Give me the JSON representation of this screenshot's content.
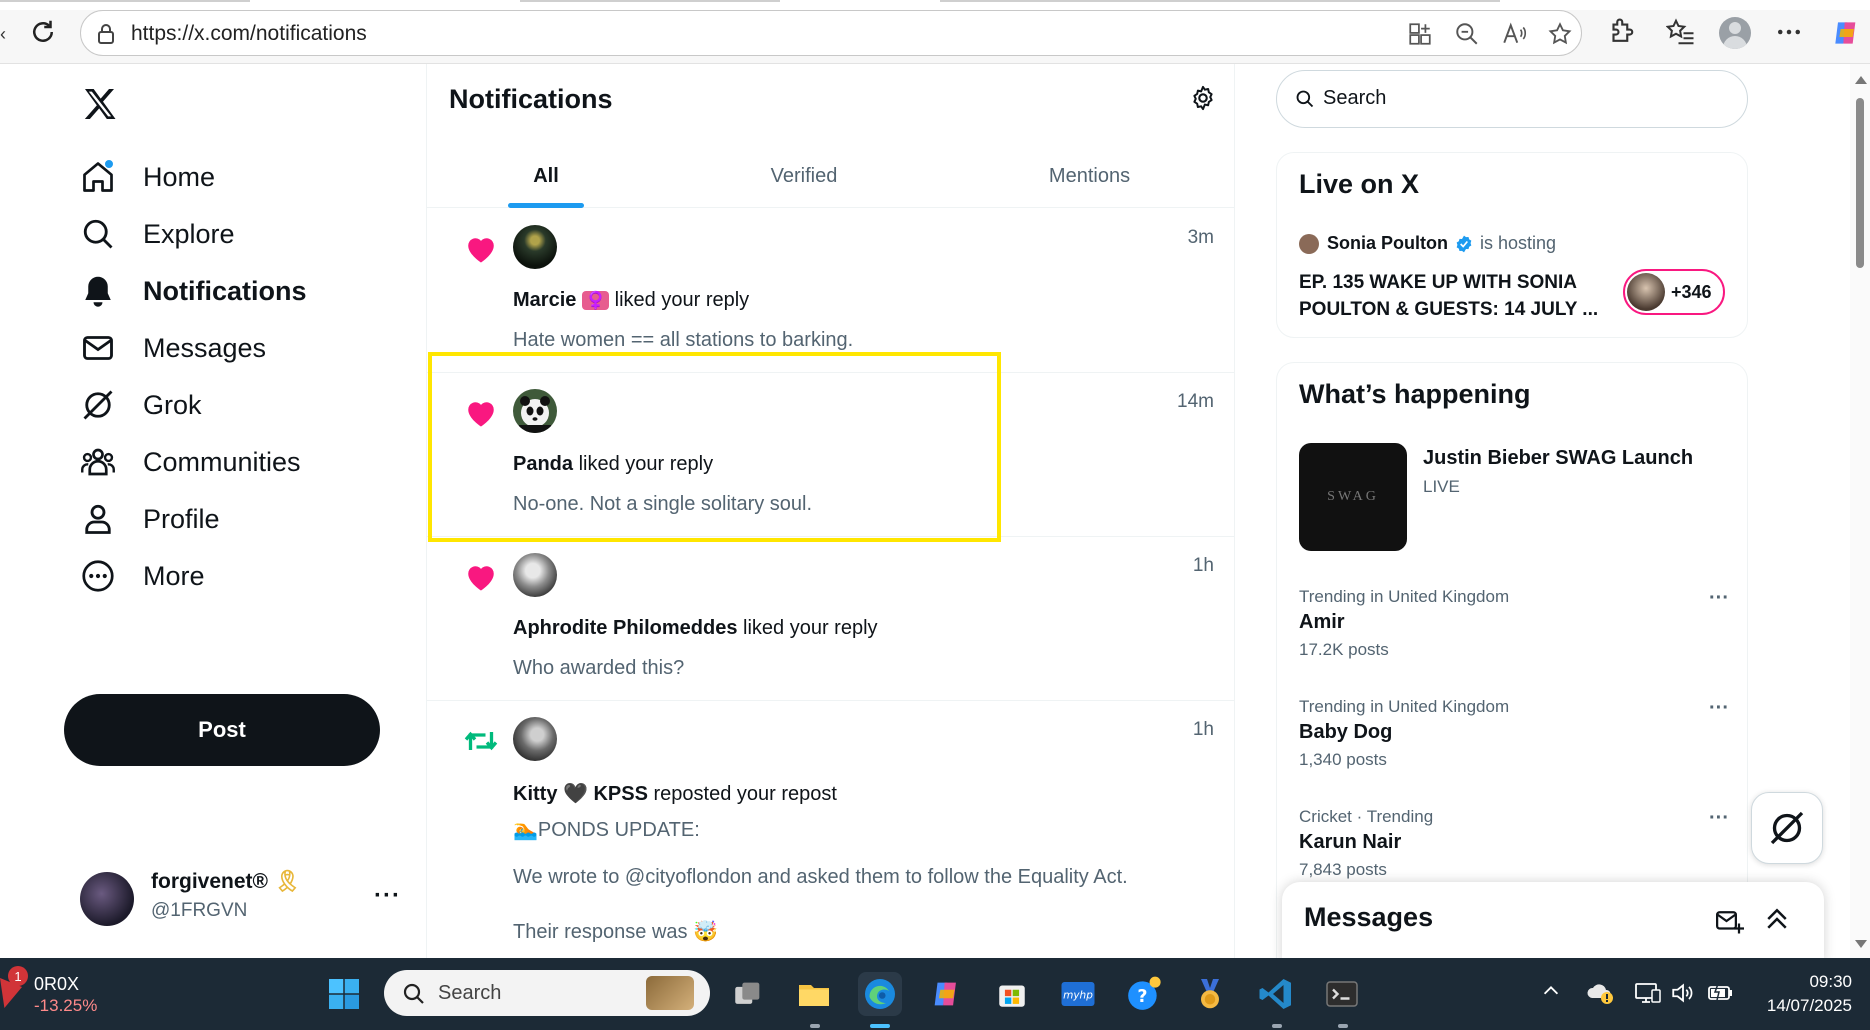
{
  "browser": {
    "url": "https://x.com/notifications"
  },
  "sidebar": {
    "items": [
      {
        "label": "Home",
        "icon": "home-icon"
      },
      {
        "label": "Explore",
        "icon": "search-icon"
      },
      {
        "label": "Notifications",
        "icon": "bell-icon"
      },
      {
        "label": "Messages",
        "icon": "envelope-icon"
      },
      {
        "label": "Grok",
        "icon": "grok-icon"
      },
      {
        "label": "Communities",
        "icon": "communities-icon"
      },
      {
        "label": "Profile",
        "icon": "person-icon"
      },
      {
        "label": "More",
        "icon": "more-circle-icon"
      }
    ],
    "post_label": "Post",
    "account": {
      "name": "forgivenet®",
      "handle": "@1FRGVN"
    }
  },
  "main": {
    "title": "Notifications",
    "tabs": [
      {
        "label": "All",
        "active": true
      },
      {
        "label": "Verified",
        "active": false
      },
      {
        "label": "Mentions",
        "active": false
      }
    ],
    "notifications": [
      {
        "type": "like",
        "user": "Marcie",
        "user_suffix": "♀️",
        "action": "liked your reply",
        "time": "3m",
        "snippet": "Hate women == all stations to barking."
      },
      {
        "type": "like",
        "user": "Panda",
        "user_suffix": "",
        "action": "liked your reply",
        "time": "14m",
        "snippet": "No-one. Not a single solitary soul."
      },
      {
        "type": "like",
        "user": "Aphrodite Philomeddes",
        "user_suffix": "",
        "action": "liked your reply",
        "time": "1h",
        "snippet": "Who awarded this?"
      },
      {
        "type": "repost",
        "user": "Kitty 🖤 KPSS",
        "user_suffix": "",
        "action": "reposted your repost",
        "time": "1h",
        "snippet_lines": [
          "🏊PONDS UPDATE:",
          "We wrote to @cityoflondon and asked them to follow the Equality Act.",
          "Their response was 🤯"
        ]
      }
    ]
  },
  "right": {
    "search_placeholder": "Search",
    "live": {
      "title": "Live on X",
      "host": "Sonia Poulton",
      "hosting_label": "is hosting",
      "show_title": "EP. 135 WAKE UP WITH SONIA POULTON & GUESTS: 14 JULY ...",
      "listeners": "+346"
    },
    "happening": {
      "title": "What’s happening",
      "featured": {
        "title": "Justin Bieber SWAG Launch",
        "status": "LIVE",
        "image_text": "SWAG"
      },
      "trends": [
        {
          "context": "Trending in United Kingdom",
          "name": "Amir",
          "count": "17.2K posts"
        },
        {
          "context": "Trending in United Kingdom",
          "name": "Baby Dog",
          "count": "1,340 posts"
        },
        {
          "context": "Cricket · Trending",
          "name": "Karun Nair",
          "count": "7,843 posts"
        }
      ]
    },
    "messages_drawer_title": "Messages"
  },
  "taskbar": {
    "stock_badge": "1",
    "stock_symbol": "0R0X",
    "stock_change": "-13.25%",
    "search_placeholder": "Search",
    "time": "09:30",
    "date": "14/07/2025"
  },
  "colors": {
    "accent": "#1d9bf0",
    "like": "#f91880",
    "repost": "#00ba7c",
    "highlight": "#ffe600"
  }
}
